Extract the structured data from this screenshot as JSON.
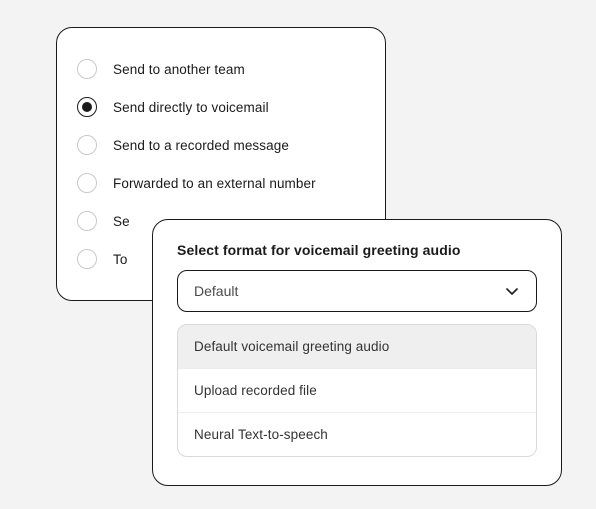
{
  "routing_options": [
    {
      "label": "Send to another team",
      "selected": false
    },
    {
      "label": "Send directly to voicemail",
      "selected": true
    },
    {
      "label": "Send to a recorded message",
      "selected": false
    },
    {
      "label": "Forwarded to an external number",
      "selected": false
    },
    {
      "label": "Se",
      "selected": false
    },
    {
      "label": "To",
      "selected": false
    }
  ],
  "format_panel": {
    "title": "Select format for voicemail greeting audio",
    "selected_value": "Default",
    "options": [
      {
        "label": "Default voicemail greeting audio",
        "highlighted": true
      },
      {
        "label": "Upload recorded file",
        "highlighted": false
      },
      {
        "label": "Neural Text-to-speech",
        "highlighted": false
      }
    ]
  }
}
